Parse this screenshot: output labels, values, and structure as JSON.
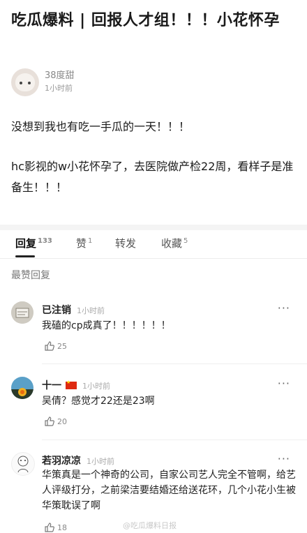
{
  "post": {
    "title": "吃瓜爆料 | 回报人才组！！！小花怀孕",
    "author": "38度甜",
    "time": "1小时前",
    "paragraph1": "没想到我也有吃一手瓜的一天！！！",
    "paragraph2": "hc影视的w小花怀孕了，去医院做产检22周，看样子是准备生！！！"
  },
  "tabs": [
    {
      "label": "回复",
      "count": "133"
    },
    {
      "label": "赞",
      "count": "1"
    },
    {
      "label": "转发",
      "count": ""
    },
    {
      "label": "收藏",
      "count": "5"
    }
  ],
  "section_label": "最赞回复",
  "comments": [
    {
      "name": "已注销",
      "time": "1小时前",
      "text": "我磕的cp成真了！！！！！！",
      "likes": "25"
    },
    {
      "name": "十一",
      "time": "1小时前",
      "text": "吴倩？感觉才22还是23啊",
      "likes": "20"
    },
    {
      "name": "若羽凉凉",
      "time": "1小时前",
      "text": "华策真是一个神奇的公司，自家公司艺人完全不管啊，给艺人评级打分，之前梁洁要结婚还给送花环，几个小花小生被华策耽误了啊",
      "likes": "18"
    }
  ],
  "more_icon": "···",
  "watermark": "@吃瓜爆料日报",
  "colors": {
    "divider": "#f4f4f4",
    "flag": "#de2910"
  }
}
